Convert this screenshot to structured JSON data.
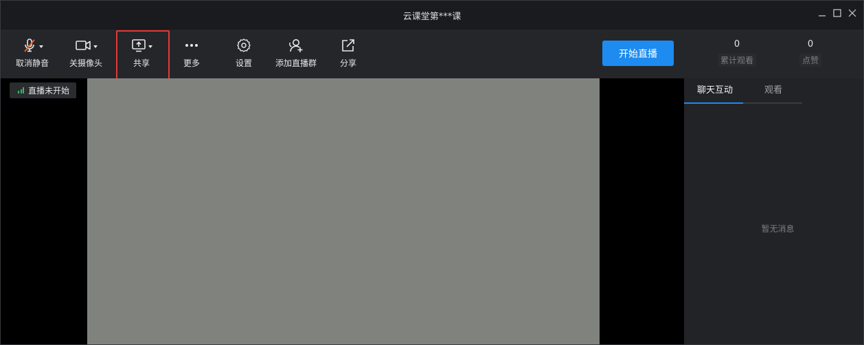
{
  "window": {
    "title": "云课堂第***课"
  },
  "toolbar": {
    "tools": [
      {
        "label": "取消静音",
        "icon": "mic-off-icon"
      },
      {
        "label": "关摄像头",
        "icon": "camera-icon"
      },
      {
        "label": "共享",
        "icon": "screen-share-icon"
      },
      {
        "label": "更多",
        "icon": "more-icon"
      },
      {
        "label": "设置",
        "icon": "gear-icon"
      },
      {
        "label": "添加直播群",
        "icon": "add-group-icon"
      },
      {
        "label": "分享",
        "icon": "share-icon"
      }
    ],
    "start_label": "开始直播",
    "stats": [
      {
        "value": "0",
        "label": "累计观看"
      },
      {
        "value": "0",
        "label": "点赞"
      }
    ]
  },
  "stage": {
    "status": "直播未开始"
  },
  "side": {
    "tabs": [
      "聊天互动",
      "观看"
    ],
    "empty_text": "暂无消息"
  },
  "colors": {
    "accent": "#1e8bf0",
    "highlight": "#e53935",
    "mic_off": "#f06a2a",
    "signal": "#2fbf5f"
  }
}
